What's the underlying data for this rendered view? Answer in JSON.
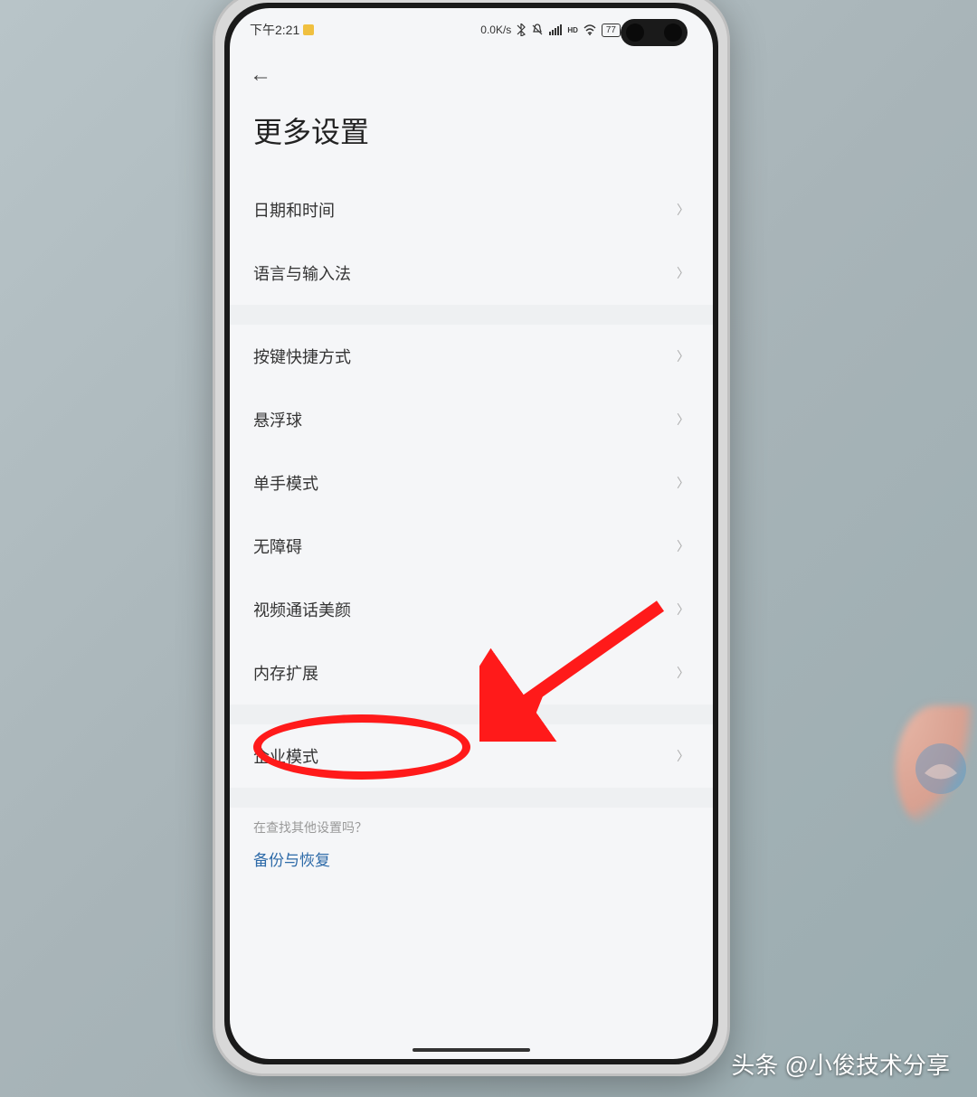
{
  "status_bar": {
    "time": "下午2:21",
    "data_speed": "0.0K/s",
    "battery_level": "77"
  },
  "page": {
    "title": "更多设置"
  },
  "section1": {
    "items": [
      {
        "label": "日期和时间"
      },
      {
        "label": "语言与输入法"
      }
    ]
  },
  "section2": {
    "items": [
      {
        "label": "按键快捷方式"
      },
      {
        "label": "悬浮球"
      },
      {
        "label": "单手模式"
      },
      {
        "label": "无障碍"
      },
      {
        "label": "视频通话美颜"
      },
      {
        "label": "内存扩展"
      }
    ]
  },
  "section3": {
    "items": [
      {
        "label": "企业模式"
      }
    ]
  },
  "footer": {
    "search_hint": "在查找其他设置吗？",
    "backup_link": "备份与恢复"
  },
  "watermark": {
    "text": "头条 @小俊技术分享"
  },
  "annotation": {
    "highlighted_item": "内存扩展",
    "style": "red-ellipse-with-arrow"
  }
}
